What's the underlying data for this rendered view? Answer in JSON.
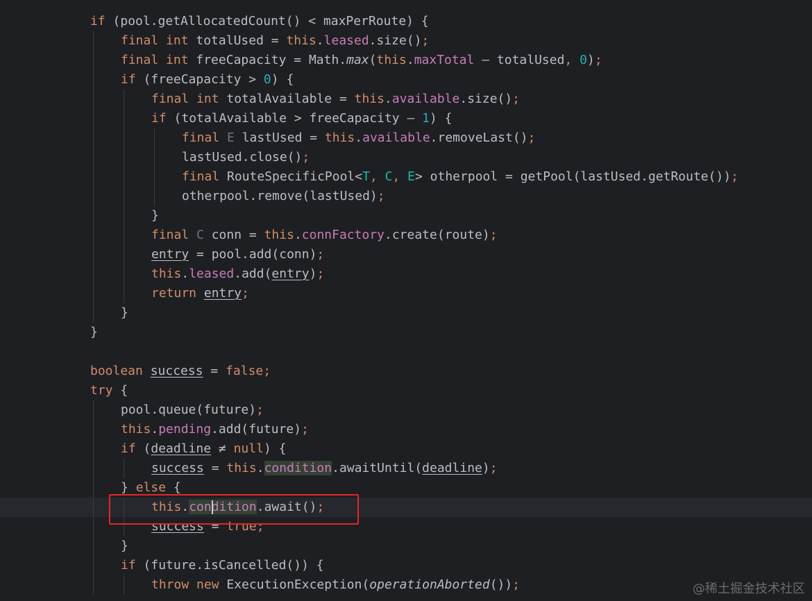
{
  "colors": {
    "background": "#1e1f22",
    "default": "#bcbec4",
    "keyword": "#cf8e6d",
    "field": "#c77dbb",
    "number": "#2aacb8",
    "type_param": "#16baac",
    "annotation_box": "#e5262a"
  },
  "code": [
    {
      "indent": 0,
      "tokens": [
        {
          "t": "if",
          "c": "kw"
        },
        {
          "t": " (pool.getAllocatedCount() < maxPerRoute) {"
        }
      ]
    },
    {
      "indent": 1,
      "tokens": [
        {
          "t": "final int",
          "c": "kw"
        },
        {
          "t": " totalUsed = "
        },
        {
          "t": "this",
          "c": "kw"
        },
        {
          "t": "."
        },
        {
          "t": "leased",
          "c": "fld"
        },
        {
          "t": ".size()"
        },
        {
          "t": ";",
          "c": "kw"
        }
      ]
    },
    {
      "indent": 1,
      "tokens": [
        {
          "t": "final int",
          "c": "kw"
        },
        {
          "t": " freeCapacity = Math."
        },
        {
          "t": "max",
          "c": "italic"
        },
        {
          "t": "("
        },
        {
          "t": "this",
          "c": "kw"
        },
        {
          "t": "."
        },
        {
          "t": "maxTotal",
          "c": "fld"
        },
        {
          "t": " – totalUsed"
        },
        {
          "t": ", ",
          "c": "kw"
        },
        {
          "t": "0",
          "c": "num"
        },
        {
          "t": ")"
        },
        {
          "t": ";",
          "c": "kw"
        }
      ]
    },
    {
      "indent": 1,
      "tokens": [
        {
          "t": "if",
          "c": "kw"
        },
        {
          "t": " (freeCapacity > "
        },
        {
          "t": "0",
          "c": "num"
        },
        {
          "t": ") {"
        }
      ]
    },
    {
      "indent": 2,
      "tokens": [
        {
          "t": "final int",
          "c": "kw"
        },
        {
          "t": " totalAvailable = "
        },
        {
          "t": "this",
          "c": "kw"
        },
        {
          "t": "."
        },
        {
          "t": "available",
          "c": "fld"
        },
        {
          "t": ".size()"
        },
        {
          "t": ";",
          "c": "kw"
        }
      ]
    },
    {
      "indent": 2,
      "tokens": [
        {
          "t": "if",
          "c": "kw"
        },
        {
          "t": " (totalAvailable > freeCapacity – "
        },
        {
          "t": "1",
          "c": "num"
        },
        {
          "t": ") {"
        }
      ]
    },
    {
      "indent": 3,
      "tokens": [
        {
          "t": "final",
          "c": "kw"
        },
        {
          "t": " "
        },
        {
          "t": "E",
          "c": "tp-dim"
        },
        {
          "t": " lastUsed = "
        },
        {
          "t": "this",
          "c": "kw"
        },
        {
          "t": "."
        },
        {
          "t": "available",
          "c": "fld"
        },
        {
          "t": ".removeLast()"
        },
        {
          "t": ";",
          "c": "kw"
        }
      ]
    },
    {
      "indent": 3,
      "tokens": [
        {
          "t": "lastUsed.close()"
        },
        {
          "t": ";",
          "c": "kw"
        }
      ]
    },
    {
      "indent": 3,
      "tokens": [
        {
          "t": "final",
          "c": "kw"
        },
        {
          "t": " RouteSpecificPool<"
        },
        {
          "t": "T",
          "c": "tp"
        },
        {
          "t": ", ",
          "c": "kw"
        },
        {
          "t": "C",
          "c": "tp"
        },
        {
          "t": ", ",
          "c": "kw"
        },
        {
          "t": "E",
          "c": "tp"
        },
        {
          "t": "> otherpool = getPool(lastUsed.getRoute())"
        },
        {
          "t": ";",
          "c": "kw"
        }
      ]
    },
    {
      "indent": 3,
      "tokens": [
        {
          "t": "otherpool.remove(lastUsed)"
        },
        {
          "t": ";",
          "c": "kw"
        }
      ]
    },
    {
      "indent": 2,
      "tokens": [
        {
          "t": "}"
        }
      ]
    },
    {
      "indent": 2,
      "tokens": [
        {
          "t": "final",
          "c": "kw"
        },
        {
          "t": " "
        },
        {
          "t": "C",
          "c": "tp-dim"
        },
        {
          "t": " conn = "
        },
        {
          "t": "this",
          "c": "kw"
        },
        {
          "t": "."
        },
        {
          "t": "connFactory",
          "c": "fld"
        },
        {
          "t": ".create(route)"
        },
        {
          "t": ";",
          "c": "kw"
        }
      ]
    },
    {
      "indent": 2,
      "tokens": [
        {
          "t": "entry",
          "c": "ul"
        },
        {
          "t": " = pool.add(conn)"
        },
        {
          "t": ";",
          "c": "kw"
        }
      ]
    },
    {
      "indent": 2,
      "tokens": [
        {
          "t": "this",
          "c": "kw"
        },
        {
          "t": "."
        },
        {
          "t": "leased",
          "c": "fld"
        },
        {
          "t": ".add("
        },
        {
          "t": "entry",
          "c": "ul"
        },
        {
          "t": ")"
        },
        {
          "t": ";",
          "c": "kw"
        }
      ]
    },
    {
      "indent": 2,
      "tokens": [
        {
          "t": "return",
          "c": "kw"
        },
        {
          "t": " "
        },
        {
          "t": "entry",
          "c": "ul"
        },
        {
          "t": ";",
          "c": "kw"
        }
      ]
    },
    {
      "indent": 1,
      "tokens": [
        {
          "t": "}"
        }
      ]
    },
    {
      "indent": 0,
      "tokens": [
        {
          "t": "}"
        }
      ]
    },
    {
      "indent": 0,
      "tokens": []
    },
    {
      "indent": 0,
      "tokens": [
        {
          "t": "boolean",
          "c": "kw"
        },
        {
          "t": " "
        },
        {
          "t": "success",
          "c": "ul"
        },
        {
          "t": " = "
        },
        {
          "t": "false",
          "c": "kw"
        },
        {
          "t": ";",
          "c": "kw"
        }
      ]
    },
    {
      "indent": 0,
      "tokens": [
        {
          "t": "try",
          "c": "kw"
        },
        {
          "t": " {"
        }
      ]
    },
    {
      "indent": 1,
      "tokens": [
        {
          "t": "pool.queue(future)"
        },
        {
          "t": ";",
          "c": "kw"
        }
      ]
    },
    {
      "indent": 1,
      "tokens": [
        {
          "t": "this",
          "c": "kw"
        },
        {
          "t": "."
        },
        {
          "t": "pending",
          "c": "fld"
        },
        {
          "t": ".add(future)"
        },
        {
          "t": ";",
          "c": "kw"
        }
      ]
    },
    {
      "indent": 1,
      "tokens": [
        {
          "t": "if",
          "c": "kw"
        },
        {
          "t": " ("
        },
        {
          "t": "deadline",
          "c": "ul"
        },
        {
          "t": " ≠ "
        },
        {
          "t": "null",
          "c": "kw"
        },
        {
          "t": ") {"
        }
      ]
    },
    {
      "indent": 2,
      "tokens": [
        {
          "t": "success",
          "c": "ul"
        },
        {
          "t": " = "
        },
        {
          "t": "this",
          "c": "kw"
        },
        {
          "t": "."
        },
        {
          "t": "condition",
          "c": "fld hl"
        },
        {
          "t": ".awaitUntil("
        },
        {
          "t": "deadline",
          "c": "ul"
        },
        {
          "t": ")"
        },
        {
          "t": ";",
          "c": "kw"
        }
      ]
    },
    {
      "indent": 1,
      "tokens": [
        {
          "t": "} "
        },
        {
          "t": "else",
          "c": "kw"
        },
        {
          "t": " {"
        }
      ]
    },
    {
      "indent": 2,
      "current": true,
      "tokens": [
        {
          "t": "this",
          "c": "kw"
        },
        {
          "t": "."
        },
        {
          "t": "condition",
          "c": "fld hl"
        },
        {
          "t": ".await()"
        },
        {
          "t": ";",
          "c": "kw"
        }
      ]
    },
    {
      "indent": 2,
      "tokens": [
        {
          "t": "success",
          "c": "ul"
        },
        {
          "t": " = "
        },
        {
          "t": "true",
          "c": "kw"
        },
        {
          "t": ";",
          "c": "kw"
        }
      ]
    },
    {
      "indent": 1,
      "tokens": [
        {
          "t": "}"
        }
      ]
    },
    {
      "indent": 1,
      "tokens": [
        {
          "t": "if",
          "c": "kw"
        },
        {
          "t": " (future.isCancelled()) {"
        }
      ]
    },
    {
      "indent": 2,
      "tokens": [
        {
          "t": "throw new",
          "c": "kw"
        },
        {
          "t": " ExecutionException("
        },
        {
          "t": "operationAborted",
          "c": "italic"
        },
        {
          "t": "())"
        },
        {
          "t": ";",
          "c": "kw"
        }
      ]
    }
  ],
  "watermark": "@稀土掘金技术社区"
}
